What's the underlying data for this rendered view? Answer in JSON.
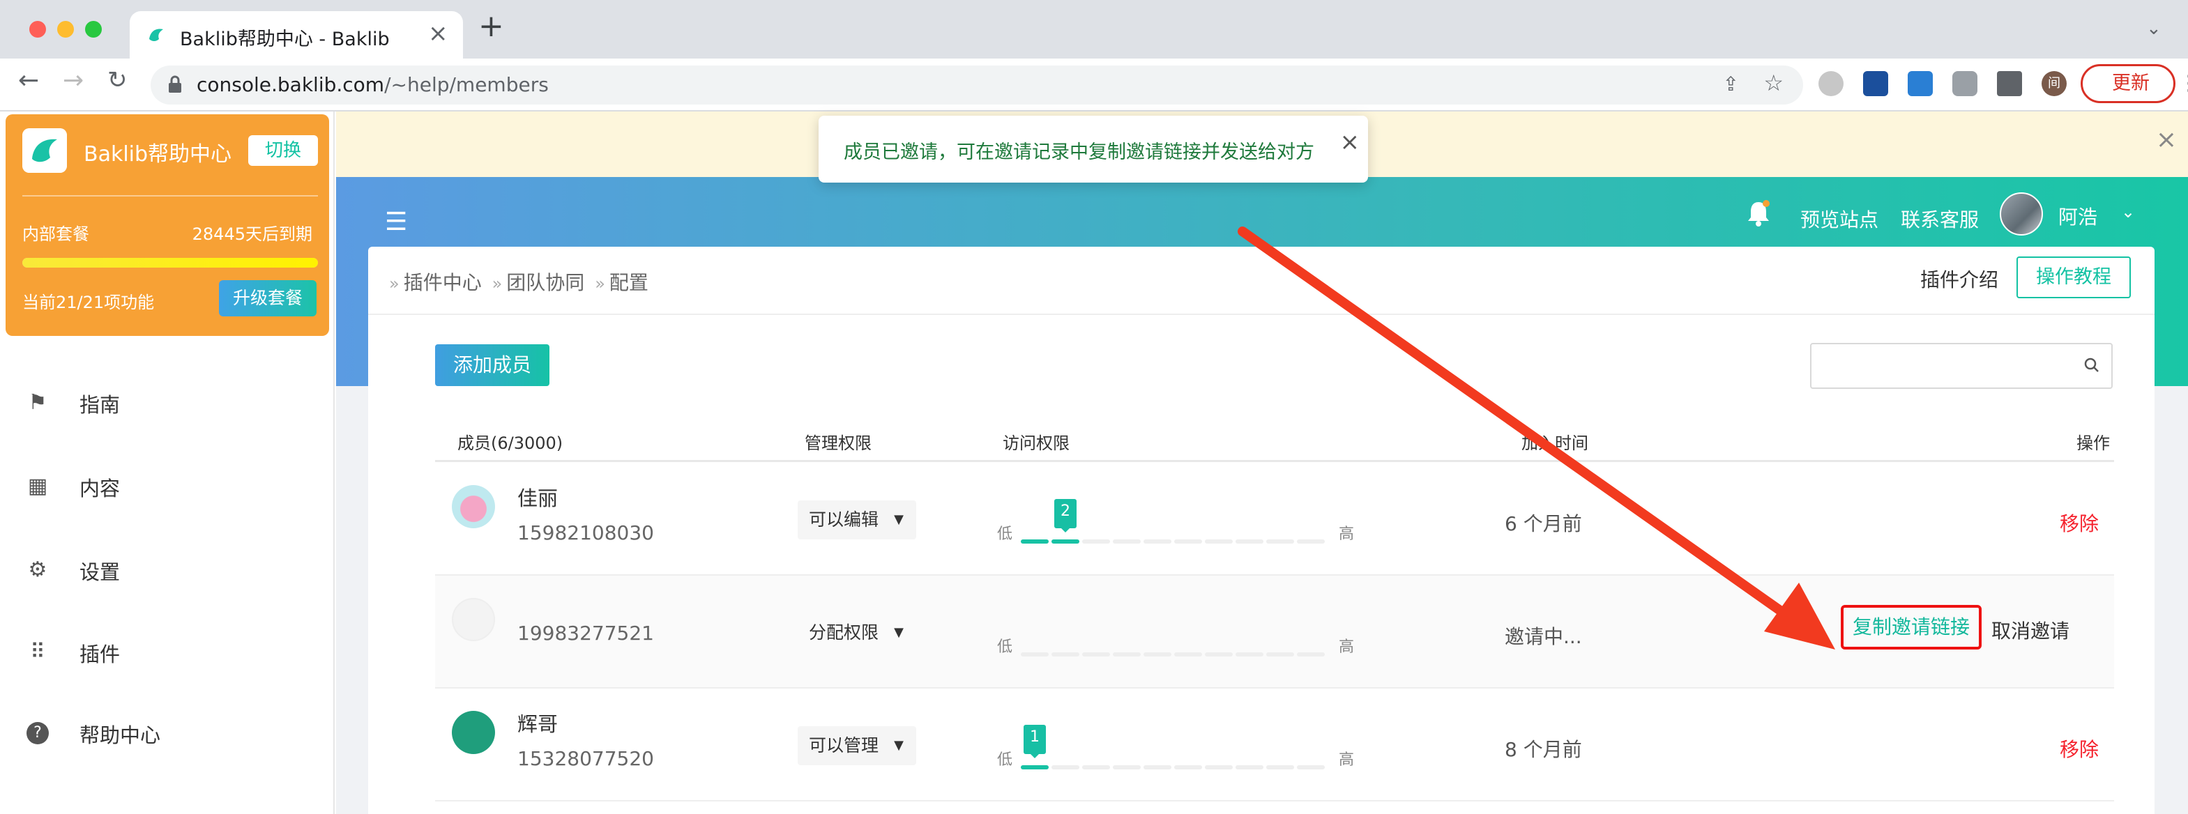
{
  "browser": {
    "tab_title": "Baklib帮助中心 - Baklib",
    "url_host": "console.baklib.com",
    "url_path": "/~help/members",
    "update_label": "更新",
    "profile_initial": "间"
  },
  "sidebar": {
    "org_name": "Baklib帮助中心",
    "switch_label": "切换",
    "plan_name": "内部套餐",
    "plan_expire": "28445天后到期",
    "plan_progress": 1.0,
    "features": "当前21/21项功能",
    "upgrade_label": "升级套餐",
    "nav": [
      {
        "label": "指南",
        "icon": "signpost-icon"
      },
      {
        "label": "内容",
        "icon": "grid-icon"
      },
      {
        "label": "设置",
        "icon": "gear-icon"
      },
      {
        "label": "插件",
        "icon": "apps-icon"
      },
      {
        "label": "帮助中心",
        "icon": "help-circle-icon"
      }
    ]
  },
  "toast": {
    "message": "成员已邀请，可在邀请记录中复制邀请链接并发送给对方"
  },
  "header": {
    "preview_label": "预览站点",
    "support_label": "联系客服",
    "user_name": "阿浩"
  },
  "breadcrumb": [
    "插件中心",
    "团队协同",
    "配置"
  ],
  "toolbar": {
    "intro_label": "插件介绍",
    "tutorial_label": "操作教程",
    "add_member_label": "添加成员",
    "search_placeholder": ""
  },
  "table": {
    "columns": [
      "成员(6/3000)",
      "管理权限",
      "访问权限",
      "加入时间",
      "操作"
    ],
    "level_low": "低",
    "level_high": "高",
    "rows": [
      {
        "name": "佳丽",
        "phone": "15982108030",
        "perm": "可以编辑",
        "level": 2,
        "time": "6 个月前",
        "action": "移除"
      },
      {
        "name": "",
        "phone": "19983277521",
        "perm": "分配权限",
        "level": 0,
        "time": "邀请中...",
        "copy_label": "复制邀请链接",
        "cancel_label": "取消邀请"
      },
      {
        "name": "辉哥",
        "phone": "15328077520",
        "perm": "可以管理",
        "level": 1,
        "time": "8 个月前",
        "action": "移除"
      }
    ]
  },
  "colors": {
    "accent": "#13c2a3",
    "danger": "#f5222d",
    "orange": "#f7a135"
  }
}
